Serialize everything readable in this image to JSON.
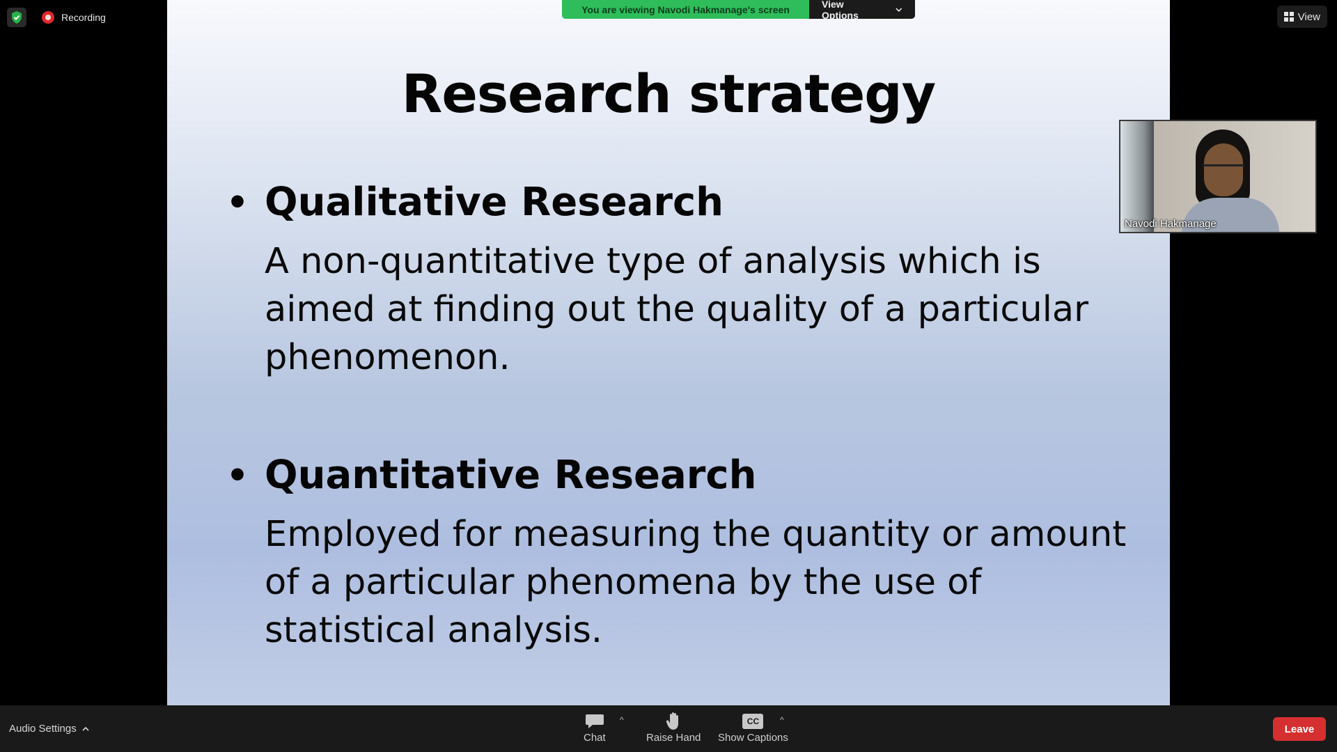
{
  "status": {
    "recording_label": "Recording"
  },
  "top_right": {
    "view_label": "View"
  },
  "share_banner": {
    "text": "You are viewing Navodi Hakmanage's screen",
    "view_options_label": "View Options"
  },
  "slide": {
    "title": "Research strategy",
    "bullets": [
      {
        "heading": "Qualitative Research",
        "body": "A non-quantitative type of analysis which is aimed at finding out the quality of a particular phenomenon."
      },
      {
        "heading": "Quantitative Research",
        "body": "Employed for measuring the quantity or amount of a particular phenomena by the use of statistical analysis."
      }
    ]
  },
  "video": {
    "participant_name": "Navodi Hakmanage"
  },
  "toolbar": {
    "audio_settings_label": "Audio Settings",
    "chat_label": "Chat",
    "raise_hand_label": "Raise Hand",
    "captions_label": "Show Captions",
    "captions_icon_text": "CC",
    "leave_label": "Leave"
  },
  "colors": {
    "banner_green": "#2ebd5a",
    "leave_red": "#d62f2f",
    "recording_red": "#e02828"
  }
}
